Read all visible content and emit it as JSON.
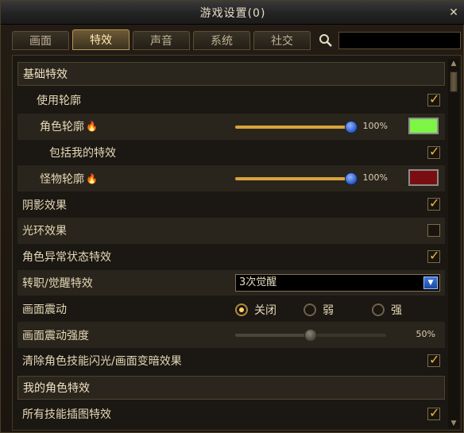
{
  "window": {
    "title": "游戏设置(0)"
  },
  "tabs": [
    {
      "label": "画面",
      "active": false
    },
    {
      "label": "特效",
      "active": true
    },
    {
      "label": "声音",
      "active": false
    },
    {
      "label": "系统",
      "active": false
    },
    {
      "label": "社交",
      "active": false
    }
  ],
  "search": {
    "value": "",
    "placeholder": ""
  },
  "sections": {
    "basic": "基础特效",
    "my_char": "我的角色特效"
  },
  "rows": {
    "outline": {
      "label": "使用轮廓",
      "checked": true
    },
    "char_outline": {
      "label": "角色轮廓",
      "value": "100%",
      "level": 1.0,
      "color": "#7cf545"
    },
    "include_mine": {
      "label": "包括我的特效",
      "checked": true
    },
    "monster_outline": {
      "label": "怪物轮廓",
      "value": "100%",
      "level": 1.0,
      "color": "#7a0d12"
    },
    "shadow": {
      "label": "阴影效果",
      "checked": true
    },
    "halo": {
      "label": "光环效果",
      "checked": false
    },
    "status_fx": {
      "label": "角色异常状态特效",
      "checked": true
    },
    "awaken": {
      "label": "转职/觉醒特效",
      "selected": "3次觉醒"
    },
    "shake": {
      "label": "画面震动",
      "options": [
        "关闭",
        "弱",
        "强"
      ],
      "selected": "关闭"
    },
    "shake_strength": {
      "label": "画面震动强度",
      "value": "50%",
      "level": 0.5
    },
    "clear_flash": {
      "label": "清除角色技能闪光/画面变暗效果",
      "checked": true
    },
    "skill_art": {
      "label": "所有技能插图特效",
      "checked": true
    }
  },
  "icons": {
    "close": "close-icon",
    "search": "search-icon",
    "fire": "fire-icon"
  },
  "colors": {
    "accent": "#f0b93a",
    "slider_fill": "#d7a33a",
    "knob": "#2a57c2"
  }
}
